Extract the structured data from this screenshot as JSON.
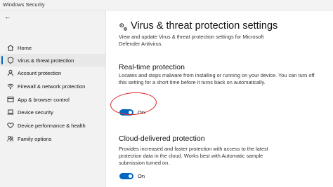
{
  "window": {
    "title": "Windows Security"
  },
  "sidebar": {
    "back_icon": "back-arrow-icon",
    "items": [
      {
        "label": "Home",
        "icon": "home-icon",
        "selected": false
      },
      {
        "label": "Virus & threat protection",
        "icon": "shield-icon",
        "selected": true
      },
      {
        "label": "Account protection",
        "icon": "person-icon",
        "selected": false
      },
      {
        "label": "Firewall & network protection",
        "icon": "wifi-icon",
        "selected": false
      },
      {
        "label": "App & browser control",
        "icon": "app-window-icon",
        "selected": false
      },
      {
        "label": "Device security",
        "icon": "laptop-icon",
        "selected": false
      },
      {
        "label": "Device performance & health",
        "icon": "heart-icon",
        "selected": false
      },
      {
        "label": "Family options",
        "icon": "family-icon",
        "selected": false
      }
    ]
  },
  "main": {
    "title": "Virus & threat protection settings",
    "title_icon": "gear-icon",
    "description": "View and update Virus & threat protection settings for Microsoft Defender Antivirus.",
    "sections": [
      {
        "title": "Real-time protection",
        "description": "Locates and stops malware from installing or running on your device. You can turn off this setting for a short time before it turns back on automatically.",
        "toggle_state": "On"
      },
      {
        "title": "Cloud-delivered protection",
        "description": "Provides increased and faster protection with access to the latest protection data in the cloud. Works best with Automatic sample submission turned on.",
        "toggle_state": "On"
      }
    ]
  },
  "colors": {
    "accent": "#0067c0",
    "annotation": "#e0262a",
    "sidebar_bg": "#f2f2f2"
  }
}
